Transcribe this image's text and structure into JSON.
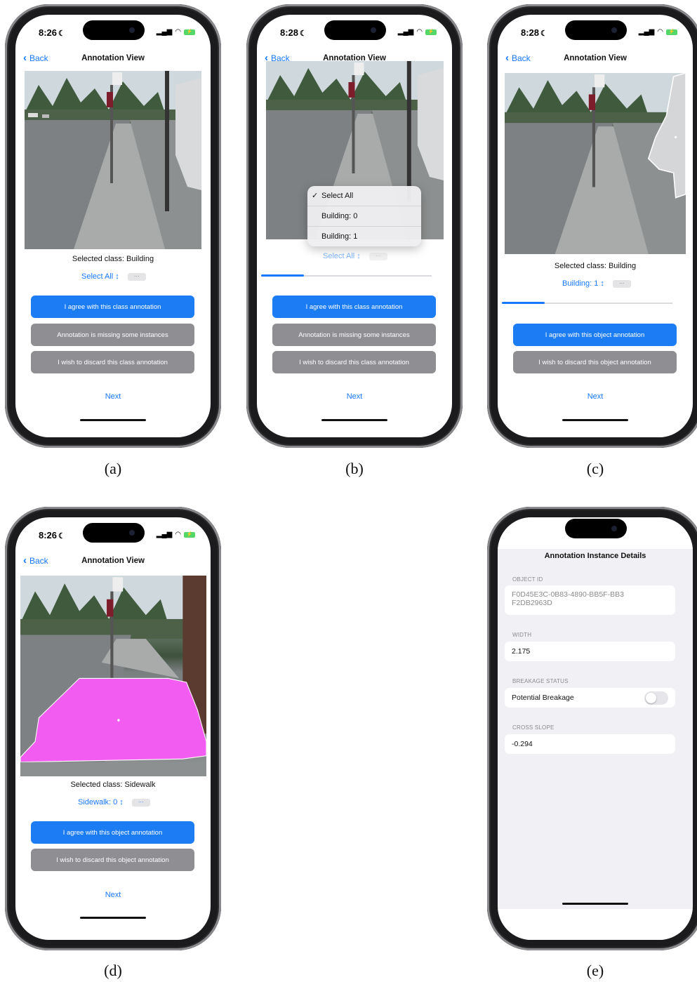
{
  "status_bar": {
    "time_a": "8:26",
    "time_b": "8:28",
    "time_c": "8:28",
    "time_d": "8:26"
  },
  "nav": {
    "back_label": "Back",
    "title": "Annotation View"
  },
  "screen_a": {
    "selected_class": "Selected class: Building",
    "picker_label": "Select All ↕",
    "buttons": [
      "I agree with this class annotation",
      "Annotation is missing some instances",
      "I wish to discard this class annotation"
    ],
    "next": "Next"
  },
  "screen_b": {
    "menu": {
      "items": [
        "Select All",
        "Building: 0",
        "Building: 1"
      ],
      "checked": "✓"
    },
    "picker_label": "Select All ↕",
    "progress": 0.25,
    "buttons": [
      "I agree with this class annotation",
      "Annotation is missing some instances",
      "I wish to discard this class annotation"
    ],
    "next": "Next"
  },
  "screen_c": {
    "selected_class": "Selected class: Building",
    "picker_label": "Building: 1 ↕",
    "progress": 0.25,
    "buttons": [
      "I agree with this object annotation",
      "I wish to discard this object annotation"
    ],
    "next": "Next"
  },
  "screen_d": {
    "selected_class": "Selected class: Sidewalk",
    "picker_label": "Sidewalk: 0 ↕",
    "buttons": [
      "I agree with this object annotation",
      "I wish to discard this object annotation"
    ],
    "next": "Next",
    "mask_color": "#f25cf0"
  },
  "screen_e": {
    "title": "Annotation Instance Details",
    "object_id_label": "OBJECT ID",
    "object_id_value": "F0D45E3C-0B83-4890-BB5F-BB3F2DB2963D",
    "width_label": "WIDTH",
    "width_value": "2.175",
    "breakage_label": "BREAKAGE STATUS",
    "breakage_row": "Potential Breakage",
    "breakage_on": false,
    "cross_slope_label": "CROSS SLOPE",
    "cross_slope_value": "-0.294"
  },
  "captions": [
    "(a)",
    "(b)",
    "(c)",
    "(d)",
    "(e)"
  ],
  "colors": {
    "accent": "#1677ff",
    "primary_button": "#1c7cf4",
    "secondary_button": "#8e8e93",
    "building_outline": "#ffffff"
  }
}
